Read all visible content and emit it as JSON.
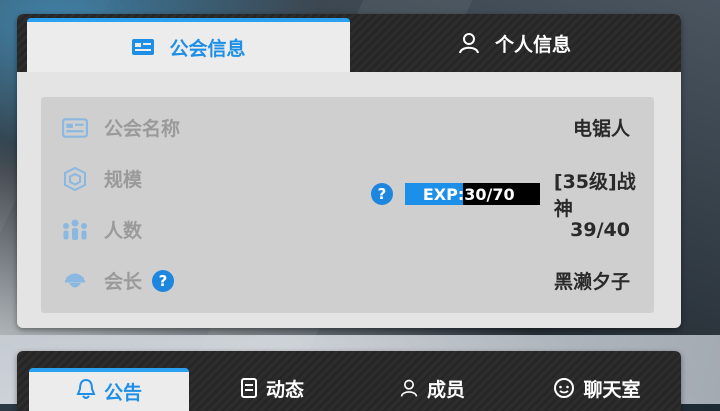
{
  "top_tabs": [
    {
      "label": "公会信息",
      "icon": "id-card-icon",
      "active": true
    },
    {
      "label": "个人信息",
      "icon": "user-icon",
      "active": false
    }
  ],
  "guild_info": {
    "name": {
      "label": "公会名称",
      "value": "电锯人",
      "icon": "id-card-icon"
    },
    "scale": {
      "label": "规模",
      "icon": "cube-icon",
      "help": "?",
      "exp_label": "EXP:",
      "exp_value": "30/70",
      "exp_current": 30,
      "exp_max": 70,
      "level_text": "[35级]战神"
    },
    "members": {
      "label": "人数",
      "value": "39/40",
      "icon": "people-icon"
    },
    "leader": {
      "label": "会长",
      "value": "黑濑夕子",
      "icon": "leader-icon",
      "help": "?"
    }
  },
  "bottom_tabs": [
    {
      "label": "公告",
      "icon": "bell-icon",
      "active": true
    },
    {
      "label": "动态",
      "icon": "document-icon",
      "active": false
    },
    {
      "label": "成员",
      "icon": "user-icon",
      "active": false
    },
    {
      "label": "聊天室",
      "icon": "chat-icon",
      "active": false
    }
  ],
  "colors": {
    "accent": "#1e8fe6",
    "exp_fill": "#1c8fe8",
    "label_gray": "#9a9a9a"
  }
}
